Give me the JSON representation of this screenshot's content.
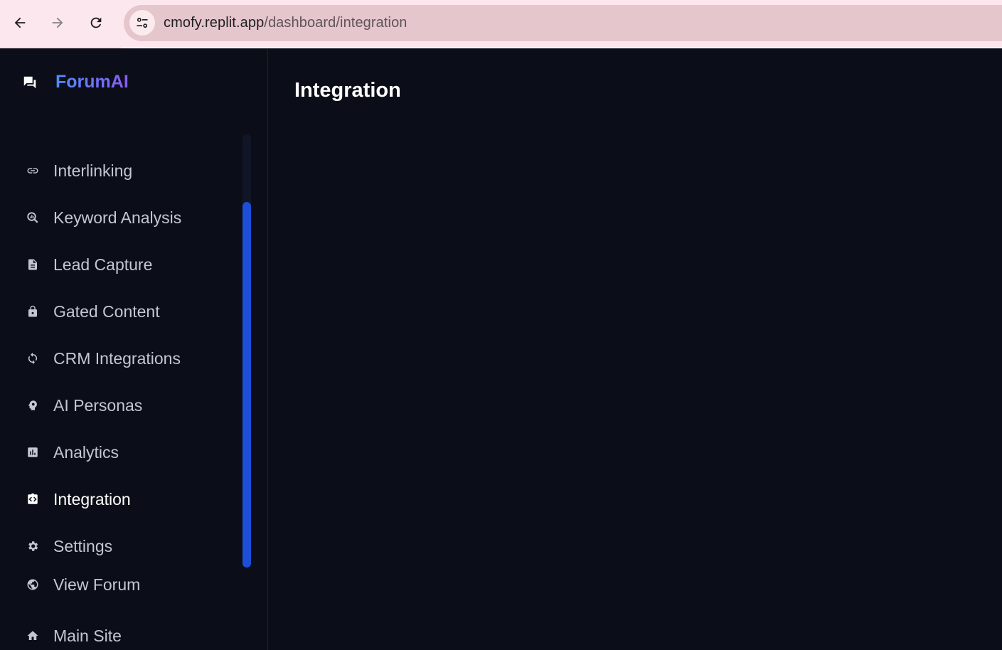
{
  "browser": {
    "url_host": "cmofy.replit.app",
    "url_path": "/dashboard/integration"
  },
  "brand": {
    "name": "ForumAI",
    "icon": "chat-bubbles-icon"
  },
  "sidebar": {
    "items": [
      {
        "label": "Interlinking",
        "icon": "link-icon"
      },
      {
        "label": "Keyword Analysis",
        "icon": "search-analytics-icon"
      },
      {
        "label": "Lead Capture",
        "icon": "document-icon"
      },
      {
        "label": "Gated Content",
        "icon": "lock-icon"
      },
      {
        "label": "CRM Integrations",
        "icon": "sync-icon"
      },
      {
        "label": "AI Personas",
        "icon": "psychology-icon"
      },
      {
        "label": "Analytics",
        "icon": "chart-icon"
      },
      {
        "label": "Integration",
        "icon": "code-icon",
        "active": true
      },
      {
        "label": "Settings",
        "icon": "gear-icon"
      },
      {
        "label": "View Forum",
        "icon": "globe-icon"
      },
      {
        "label": "Main Site",
        "icon": "home-icon"
      }
    ]
  },
  "main": {
    "title": "Integration"
  },
  "colors": {
    "background": "#0b0e18",
    "accent": "#1d4ed8",
    "brand_gradient_start": "#4f8cff",
    "brand_gradient_end": "#8a5cf6",
    "browser_bar": "#fde7ee"
  }
}
